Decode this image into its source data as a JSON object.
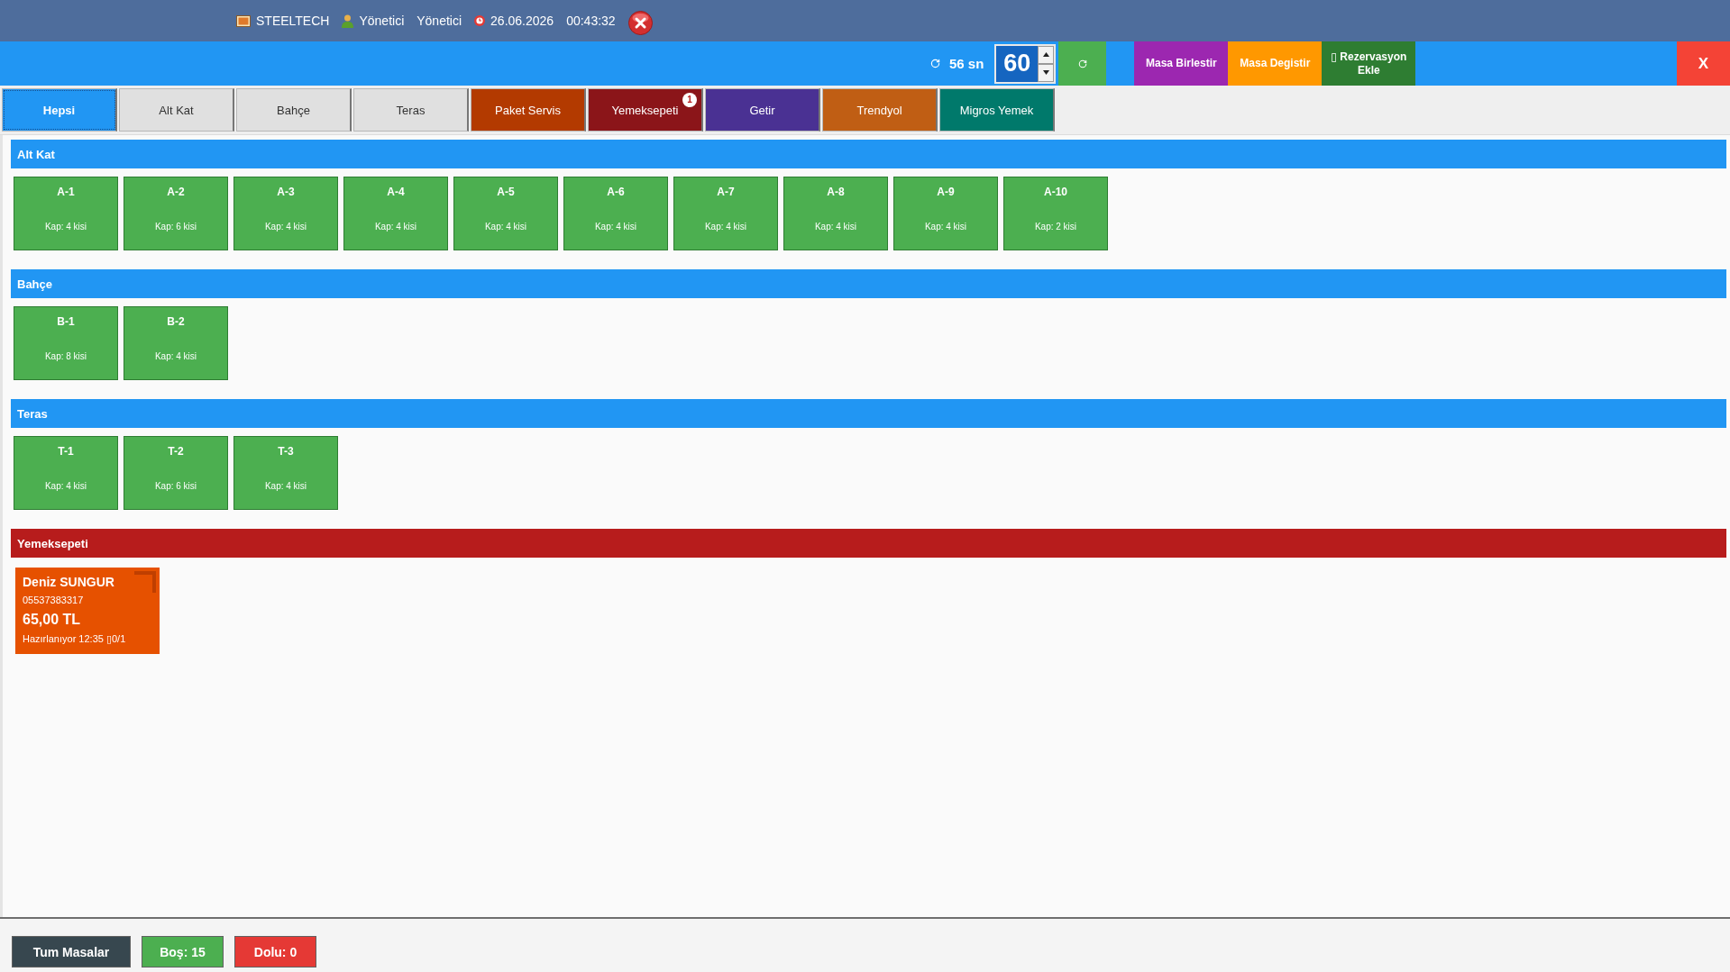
{
  "header": {
    "brand": "STEELTECH",
    "user": "Yönetici",
    "role": "Yönetici",
    "date": "26.06.2026",
    "time": "00:43:32"
  },
  "toolbar": {
    "countdown": "56 sn",
    "interval": {
      "value": "60"
    },
    "actions": [
      {
        "label": "Masa Birlestir",
        "color": "#9c27b0"
      },
      {
        "label": "Masa Degistir",
        "color": "#ff9800"
      },
      {
        "label": "▯ Rezervasyon Ekle",
        "color": "#2e7d32"
      }
    ],
    "close": {
      "label": "X"
    }
  },
  "tabs": [
    {
      "label": "Hepsi",
      "selected": true
    },
    {
      "label": "Alt Kat",
      "selected": false
    },
    {
      "label": "Bahçe",
      "selected": false
    },
    {
      "label": "Teras",
      "selected": false
    },
    {
      "label": "Paket Servis",
      "selected": false,
      "color": "#b33a00"
    },
    {
      "label": "Yemeksepeti",
      "selected": false,
      "color": "#8b1519",
      "badge": "1"
    },
    {
      "label": "Getir",
      "selected": false,
      "color": "#4a3193"
    },
    {
      "label": "Trendyol",
      "selected": false,
      "color": "#c05e14"
    },
    {
      "label": "Migros Yemek",
      "selected": false,
      "color": "#00796b"
    }
  ],
  "sections": [
    {
      "title": "Alt Kat",
      "kind": "floor",
      "tables": [
        {
          "name": "A-1",
          "capacity": "Kap: 4 kisi",
          "occupied": false
        },
        {
          "name": "A-2",
          "capacity": "Kap: 6 kisi",
          "occupied": false
        },
        {
          "name": "A-3",
          "capacity": "Kap: 4 kisi",
          "occupied": false
        },
        {
          "name": "A-4",
          "capacity": "Kap: 4 kisi",
          "occupied": false
        },
        {
          "name": "A-5",
          "capacity": "Kap: 4 kisi",
          "occupied": false
        },
        {
          "name": "A-6",
          "capacity": "Kap: 4 kisi",
          "occupied": false
        },
        {
          "name": "A-7",
          "capacity": "Kap: 4 kisi",
          "occupied": false
        },
        {
          "name": "A-8",
          "capacity": "Kap: 4 kisi",
          "occupied": false
        },
        {
          "name": "A-9",
          "capacity": "Kap: 4 kisi",
          "occupied": false
        },
        {
          "name": "A-10",
          "capacity": "Kap: 2 kisi",
          "occupied": false
        }
      ]
    },
    {
      "title": "Bahçe",
      "kind": "floor",
      "tables": [
        {
          "name": "B-1",
          "capacity": "Kap: 8 kisi",
          "occupied": false
        },
        {
          "name": "B-2",
          "capacity": "Kap: 4 kisi",
          "occupied": false
        }
      ]
    },
    {
      "title": "Teras",
      "kind": "floor",
      "tables": [
        {
          "name": "T-1",
          "capacity": "Kap: 4 kisi",
          "occupied": false
        },
        {
          "name": "T-2",
          "capacity": "Kap: 6 kisi",
          "occupied": false
        },
        {
          "name": "T-3",
          "capacity": "Kap: 4 kisi",
          "occupied": false
        }
      ]
    },
    {
      "title": "Yemeksepeti",
      "kind": "delivery",
      "orders": [
        {
          "customer": "Deniz SUNGUR",
          "phone": "05537383317",
          "total": "65,00 TL",
          "status": "Hazırlanıyor 12:35 ▯0/1"
        }
      ]
    }
  ],
  "status_bar": {
    "buttons": [
      {
        "label": "Tum Masalar",
        "color": "#37474f"
      },
      {
        "label": "Boş: 15",
        "color": "#4caf50"
      },
      {
        "label": "Dolu: 0",
        "color": "#e53935"
      }
    ]
  }
}
